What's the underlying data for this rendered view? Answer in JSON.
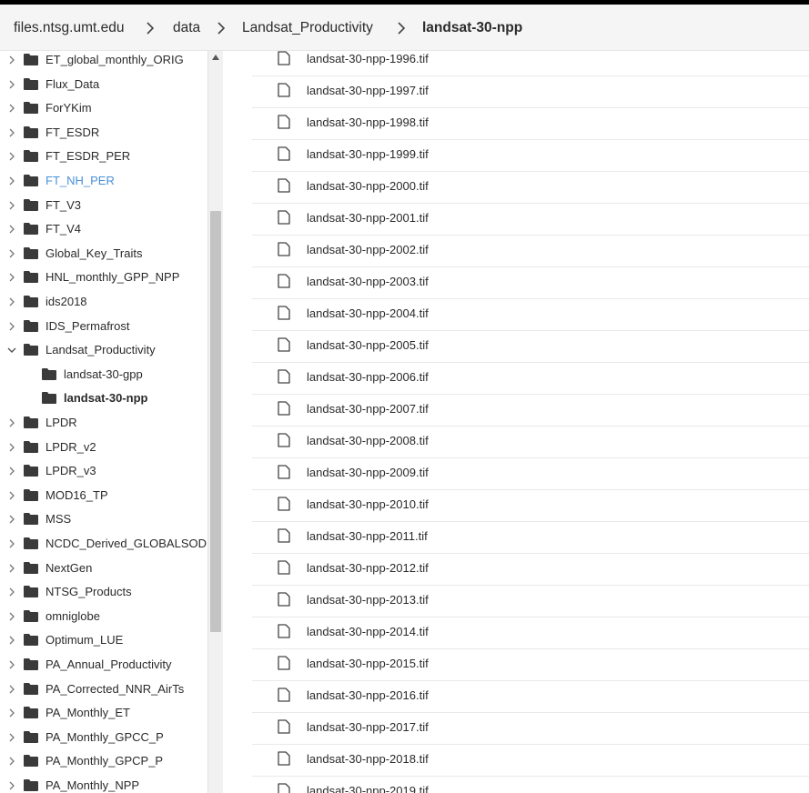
{
  "breadcrumb": [
    {
      "label": "files.ntsg.umt.edu",
      "current": false
    },
    {
      "label": "data",
      "current": false
    },
    {
      "label": "Landsat_Productivity",
      "current": false
    },
    {
      "label": "landsat-30-npp",
      "current": true
    }
  ],
  "sidebar": {
    "items": [
      {
        "label": "ET_global_monthly_ORIG",
        "level": 0,
        "expanded": false,
        "highlight": false,
        "selected": false
      },
      {
        "label": "Flux_Data",
        "level": 0,
        "expanded": false,
        "highlight": false,
        "selected": false
      },
      {
        "label": "ForYKim",
        "level": 0,
        "expanded": false,
        "highlight": false,
        "selected": false
      },
      {
        "label": "FT_ESDR",
        "level": 0,
        "expanded": false,
        "highlight": false,
        "selected": false
      },
      {
        "label": "FT_ESDR_PER",
        "level": 0,
        "expanded": false,
        "highlight": false,
        "selected": false
      },
      {
        "label": "FT_NH_PER",
        "level": 0,
        "expanded": false,
        "highlight": true,
        "selected": false
      },
      {
        "label": "FT_V3",
        "level": 0,
        "expanded": false,
        "highlight": false,
        "selected": false
      },
      {
        "label": "FT_V4",
        "level": 0,
        "expanded": false,
        "highlight": false,
        "selected": false
      },
      {
        "label": "Global_Key_Traits",
        "level": 0,
        "expanded": false,
        "highlight": false,
        "selected": false
      },
      {
        "label": "HNL_monthly_GPP_NPP",
        "level": 0,
        "expanded": false,
        "highlight": false,
        "selected": false
      },
      {
        "label": "ids2018",
        "level": 0,
        "expanded": false,
        "highlight": false,
        "selected": false
      },
      {
        "label": "IDS_Permafrost",
        "level": 0,
        "expanded": false,
        "highlight": false,
        "selected": false
      },
      {
        "label": "Landsat_Productivity",
        "level": 0,
        "expanded": true,
        "highlight": false,
        "selected": false
      },
      {
        "label": "landsat-30-gpp",
        "level": 1,
        "expanded": false,
        "highlight": false,
        "selected": false
      },
      {
        "label": "landsat-30-npp",
        "level": 1,
        "expanded": false,
        "highlight": false,
        "selected": true
      },
      {
        "label": "LPDR",
        "level": 0,
        "expanded": false,
        "highlight": false,
        "selected": false
      },
      {
        "label": "LPDR_v2",
        "level": 0,
        "expanded": false,
        "highlight": false,
        "selected": false
      },
      {
        "label": "LPDR_v3",
        "level": 0,
        "expanded": false,
        "highlight": false,
        "selected": false
      },
      {
        "label": "MOD16_TP",
        "level": 0,
        "expanded": false,
        "highlight": false,
        "selected": false
      },
      {
        "label": "MSS",
        "level": 0,
        "expanded": false,
        "highlight": false,
        "selected": false
      },
      {
        "label": "NCDC_Derived_GLOBALSOD",
        "level": 0,
        "expanded": false,
        "highlight": false,
        "selected": false
      },
      {
        "label": "NextGen",
        "level": 0,
        "expanded": false,
        "highlight": false,
        "selected": false
      },
      {
        "label": "NTSG_Products",
        "level": 0,
        "expanded": false,
        "highlight": false,
        "selected": false
      },
      {
        "label": "omniglobe",
        "level": 0,
        "expanded": false,
        "highlight": false,
        "selected": false
      },
      {
        "label": "Optimum_LUE",
        "level": 0,
        "expanded": false,
        "highlight": false,
        "selected": false
      },
      {
        "label": "PA_Annual_Productivity",
        "level": 0,
        "expanded": false,
        "highlight": false,
        "selected": false
      },
      {
        "label": "PA_Corrected_NNR_AirTs",
        "level": 0,
        "expanded": false,
        "highlight": false,
        "selected": false
      },
      {
        "label": "PA_Monthly_ET",
        "level": 0,
        "expanded": false,
        "highlight": false,
        "selected": false
      },
      {
        "label": "PA_Monthly_GPCC_P",
        "level": 0,
        "expanded": false,
        "highlight": false,
        "selected": false
      },
      {
        "label": "PA_Monthly_GPCP_P",
        "level": 0,
        "expanded": false,
        "highlight": false,
        "selected": false
      },
      {
        "label": "PA_Monthly_NPP",
        "level": 0,
        "expanded": false,
        "highlight": false,
        "selected": false
      }
    ]
  },
  "files": [
    "landsat-30-npp-1996.tif",
    "landsat-30-npp-1997.tif",
    "landsat-30-npp-1998.tif",
    "landsat-30-npp-1999.tif",
    "landsat-30-npp-2000.tif",
    "landsat-30-npp-2001.tif",
    "landsat-30-npp-2002.tif",
    "landsat-30-npp-2003.tif",
    "landsat-30-npp-2004.tif",
    "landsat-30-npp-2005.tif",
    "landsat-30-npp-2006.tif",
    "landsat-30-npp-2007.tif",
    "landsat-30-npp-2008.tif",
    "landsat-30-npp-2009.tif",
    "landsat-30-npp-2010.tif",
    "landsat-30-npp-2011.tif",
    "landsat-30-npp-2012.tif",
    "landsat-30-npp-2013.tif",
    "landsat-30-npp-2014.tif",
    "landsat-30-npp-2015.tif",
    "landsat-30-npp-2016.tif",
    "landsat-30-npp-2017.tif",
    "landsat-30-npp-2018.tif",
    "landsat-30-npp-2019.tif"
  ],
  "icons": {
    "folder": "folder-icon",
    "file": "file-icon",
    "chevron_right": "chevron-right-icon",
    "chevron_down": "chevron-down-icon",
    "breadcrumb_separator": "chevron-right-icon",
    "scroll_up": "arrow-up-icon"
  },
  "colors": {
    "highlight_text": "#4a90d9",
    "folder": "#3a3a3a",
    "header_bg": "#f5f5f5"
  }
}
